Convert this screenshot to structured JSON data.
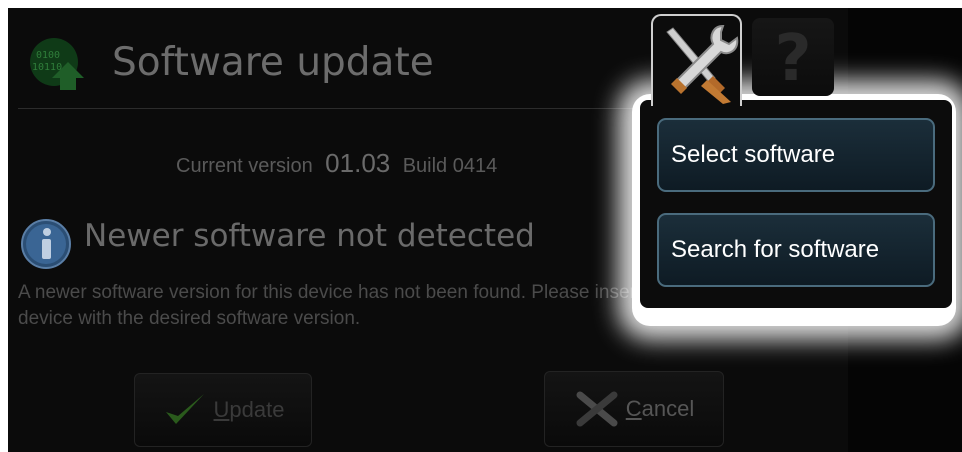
{
  "header": {
    "title": "Software update"
  },
  "version": {
    "label": "Current version",
    "number": "01.03",
    "build": "Build 0414"
  },
  "notice": {
    "title": "Newer software not detected",
    "body": "A newer software version for this device has not been found. Please insert an USB device with the desired software version."
  },
  "buttons": {
    "update_prefix": "U",
    "update_rest": "pdate",
    "cancel_prefix": "C",
    "cancel_rest": "ancel"
  },
  "menu": {
    "items": [
      "Select software",
      "Search for software"
    ]
  },
  "tabs": {
    "tools_icon": "tools-icon",
    "help_icon": "help-icon",
    "help_glyph": "?"
  },
  "colors": {
    "menu_border": "#4a6b7d",
    "menu_fill": "#1b2e3a",
    "check_green": "#2e6a1e"
  }
}
